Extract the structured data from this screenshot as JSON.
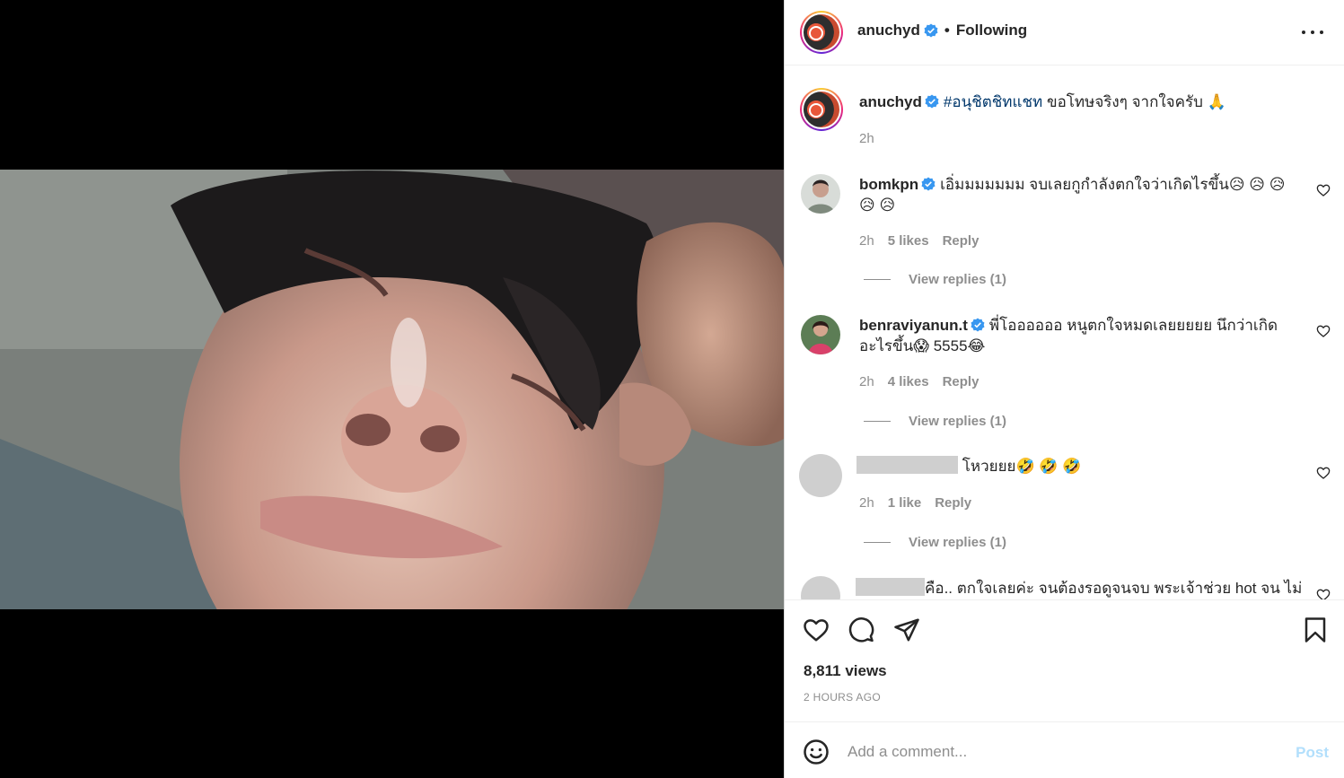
{
  "post": {
    "author": "anuchyd",
    "follow_status": "Following",
    "caption_hashtag": "#อนุชิตชิทแชท",
    "caption_text": "ขอโทษจริงๆ จากใจครับ 🙏",
    "caption_age": "2h",
    "views": "8,811 views",
    "posted": "2 HOURS AGO"
  },
  "comments": [
    {
      "user": "bomkpn",
      "text": "เอิ่มมมมมมม จบเลยกูกำลังตกใจว่าเกิดไรขึ้น😥 😥 😥 😥 😥",
      "age": "2h",
      "likes": "5 likes",
      "reply": "Reply",
      "view_replies": "View replies (1)"
    },
    {
      "user": "benraviyanun.t",
      "text": "พี่โออออออ หนูตกใจหมดเลยยยยย นึกว่าเกิดอะไรขึ้น😱 5555😂",
      "age": "2h",
      "likes": "4 likes",
      "reply": "Reply",
      "view_replies": "View replies (1)"
    },
    {
      "text": "โหวยยย🤣 🤣 🤣",
      "age": "2h",
      "likes": "1 like",
      "reply": "Reply",
      "view_replies": "View replies (1)"
    },
    {
      "text": "คือ.. ตกใจเลยค่ะ จนต้องรอดูจนจบ พระเจ้าช่วย hot จน ไม่"
    }
  ],
  "composer": {
    "placeholder": "Add a comment...",
    "post_label": "Post"
  },
  "icons": {
    "verified": "verified-badge-icon",
    "like": "heart-icon",
    "comment": "comment-bubble-icon",
    "share": "paper-plane-icon",
    "save": "bookmark-icon",
    "emoji": "smiley-icon",
    "mute": "speaker-icon",
    "more": "more-options-icon"
  },
  "colors": {
    "verified": "#3897f0",
    "hashtag": "#00376b",
    "muted_text": "#8e8e8e",
    "post_disabled": "#b2dffc"
  }
}
